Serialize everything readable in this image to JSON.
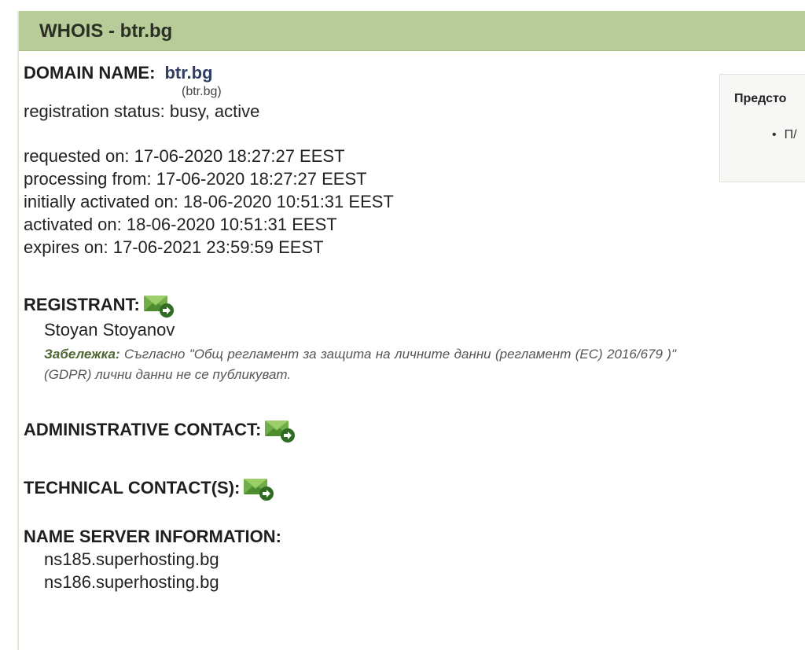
{
  "panel": {
    "title": "WHOIS - btr.bg"
  },
  "domain": {
    "label": "DOMAIN NAME:",
    "name": "btr.bg",
    "sub": "(btr.bg)",
    "status": "registration status: busy, active"
  },
  "dates": [
    "requested on: 17-06-2020 18:27:27 EEST",
    "processing from: 17-06-2020 18:27:27 EEST",
    "initially activated on: 18-06-2020 10:51:31 EEST",
    "activated on: 18-06-2020 10:51:31 EEST",
    "expires on: 17-06-2021 23:59:59 EEST"
  ],
  "registrant": {
    "label": "REGISTRANT:",
    "name": "Stoyan Stoyanov",
    "note_label": "Забележка:",
    "note_text": " Съгласно \"Общ регламент за защита на личните данни (регламент (ЕС) 2016/679 )\" (GDPR) лични данни не се публикуват."
  },
  "admin": {
    "label": "ADMINISTRATIVE CONTACT:"
  },
  "tech": {
    "label": "TECHNICAL CONTACT(S):"
  },
  "nameservers": {
    "label": "NAME SERVER INFORMATION:",
    "items": [
      "ns185.superhosting.bg",
      "ns186.superhosting.bg"
    ]
  },
  "side": {
    "title": "Предсто",
    "item": "П/"
  },
  "icons": {
    "contact": "mail-forward-icon"
  },
  "colors": {
    "header_bg": "#b8cc9a",
    "domain_link": "#2f3f63",
    "icon_green": "#5a9a3a"
  }
}
